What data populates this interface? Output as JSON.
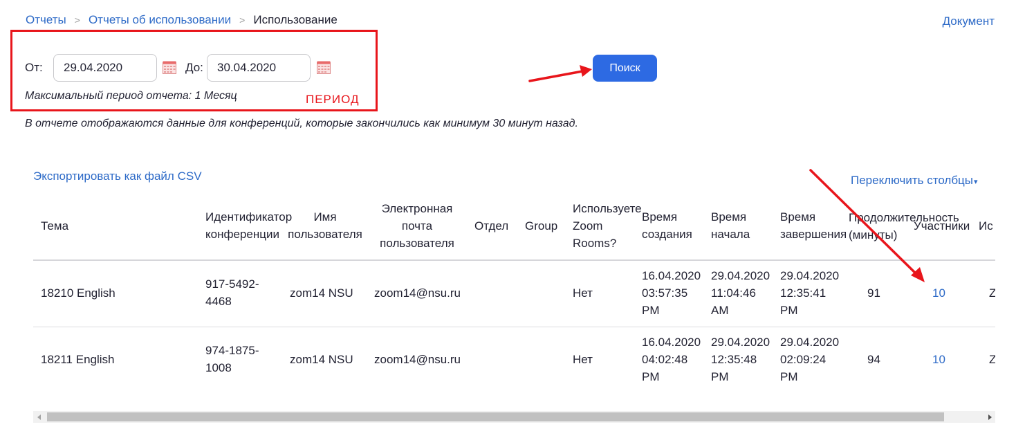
{
  "breadcrumb": {
    "items": [
      "Отчеты",
      "Отчеты об использовании"
    ],
    "current": "Использование",
    "separator": ">"
  },
  "header": {
    "doc_link": "Документ"
  },
  "filters": {
    "from_label": "От:",
    "from_value": "29.04.2020",
    "to_label": "До:",
    "to_value": "30.04.2020",
    "max_period_note": "Максимальный период отчета: 1 Месяц",
    "annotation_label": "ПЕРИОД",
    "search_button": "Поиск"
  },
  "report_note": "В отчете отображаются данные для конференций, которые закончились как минимум 30 минут назад.",
  "actions": {
    "export_csv": "Экспортировать как файл CSV",
    "toggle_columns": "Переключить столбцы",
    "toggle_caret": "▾"
  },
  "table": {
    "headers": {
      "topic": "Тема",
      "meeting_id": [
        "Идентификатор",
        "конференции"
      ],
      "user_name": [
        "Имя",
        "пользователя"
      ],
      "user_email": [
        "Электронная",
        "почта",
        "пользователя"
      ],
      "department": "Отдел",
      "group": "Group",
      "zoom_rooms": [
        "Используете",
        "Zoom",
        "Rooms?"
      ],
      "created": [
        "Время",
        "создания"
      ],
      "start": [
        "Время",
        "начала"
      ],
      "end": [
        "Время",
        "завершения"
      ],
      "duration": [
        "Продолжительность",
        "(минуты)"
      ],
      "participants": "Участники",
      "source": "Ис"
    },
    "rows": [
      {
        "topic": "18210 English",
        "meeting_id": [
          "917-5492-",
          "4468"
        ],
        "user_name": "zom14 NSU",
        "user_email": "zoom14@nsu.ru",
        "department": "",
        "group": "",
        "zoom_rooms": "Нет",
        "created": [
          "16.04.2020",
          "03:57:35",
          "PM"
        ],
        "start": [
          "29.04.2020",
          "11:04:46",
          "AM"
        ],
        "end": [
          "29.04.2020",
          "12:35:41",
          "PM"
        ],
        "duration": "91",
        "participants": "10",
        "source": "Z"
      },
      {
        "topic": "18211 English",
        "meeting_id": [
          "974-1875-",
          "1008"
        ],
        "user_name": "zom14 NSU",
        "user_email": "zoom14@nsu.ru",
        "department": "",
        "group": "",
        "zoom_rooms": "Нет",
        "created": [
          "16.04.2020",
          "04:02:48",
          "PM"
        ],
        "start": [
          "29.04.2020",
          "12:35:48",
          "PM"
        ],
        "end": [
          "29.04.2020",
          "02:09:24",
          "PM"
        ],
        "duration": "94",
        "participants": "10",
        "source": "Z"
      }
    ]
  },
  "colors": {
    "link": "#2d6ac7",
    "primary_button": "#2d6ae3",
    "annotation_red": "#e8151b",
    "text": "#232333"
  },
  "icons": {
    "calendar": "calendar-icon",
    "scroll_left": "scroll-left-arrow-icon",
    "scroll_right": "scroll-right-arrow-icon"
  }
}
